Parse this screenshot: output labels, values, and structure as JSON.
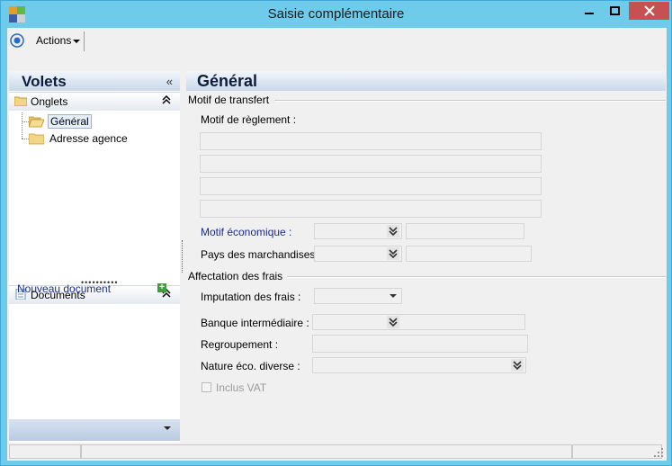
{
  "window": {
    "title": "Saisie complémentaire",
    "icon": "app-icon"
  },
  "toolbar": {
    "icon": "target-icon",
    "actions_label": "Actions"
  },
  "left_panel": {
    "title": "Volets",
    "collapse_glyph": "«",
    "tabs_group": {
      "label": "Onglets",
      "chevron": "⌃⌃",
      "items": [
        {
          "label": "Général",
          "selected": true
        },
        {
          "label": "Adresse agence",
          "selected": false
        }
      ]
    },
    "splitter_dots": "••••••••••",
    "documents_group": {
      "label": "Documents",
      "chevron": "⌃⌃",
      "new_document": "Nouveau document"
    }
  },
  "main": {
    "title": "Général",
    "motif_section": {
      "label": "Motif de transfert",
      "motif_reglement_label": "Motif de règlement :",
      "motif_economique_label": "Motif économique :",
      "pays_marchandises_label": "Pays des marchandises :"
    },
    "affectation_section": {
      "label": "Affectation des frais",
      "imputation_label": "Imputation des frais :",
      "banque_label": "Banque intermédiaire :",
      "regroupement_label": "Regroupement :",
      "nature_label": "Nature éco. diverse :",
      "inclus_vat_label": "Inclus VAT",
      "inclus_vat_checked": false
    }
  },
  "colors": {
    "title_bar": "#6ecbea",
    "close_button": "#c75050",
    "link": "#1a2e8a",
    "panel_header": "#c9d8ea"
  }
}
